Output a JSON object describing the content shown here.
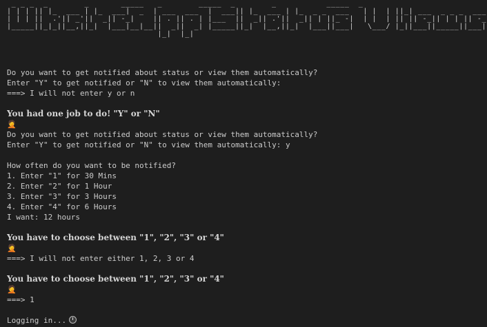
{
  "banner": {
    "ascii_art": " _ _ _  _        _       _____   _        _____  _        _           _____  _\n| | | || |_  ___ | |_  ___|  _  | ___  ___  |  ___|| |_  ___ | |_  _ _  ___   | |  | ||_| ___  _ _ _  ___  ___\n| | | ||  .'|| _'||  _|| -_|    || . || . | |___  ||  _|| .'||  _|| | ||_ -|  | |  | || || -_|| | | || -_||  _|\n|_____||_|_||__,||_|  |___|__|__||  _||  _| |_____||_|  |__,||_|  |___||___|   \\___/ |_||___||_____||___||_|\n                                 |_|  |_|"
  },
  "terminal": {
    "lines": [
      {
        "text": "Do you want to get notified about status or view them automatically?",
        "style": "normal"
      },
      {
        "text": "Enter \"Y\" to get notified or \"N\" to view them automatically:",
        "style": "normal"
      },
      {
        "text": "===> I will not enter y or n",
        "style": "normal"
      },
      {
        "text": "",
        "style": "normal"
      },
      {
        "text": "You had one job to do! \"Y\" or \"N\"",
        "style": "bold"
      },
      {
        "text": "🤦",
        "style": "emoji"
      },
      {
        "text": "Do you want to get notified about status or view them automatically?",
        "style": "normal"
      },
      {
        "text": "Enter \"Y\" to get notified or \"N\" to view them automatically: y",
        "style": "normal"
      },
      {
        "text": "",
        "style": "normal"
      },
      {
        "text": "How often do you want to be notified?",
        "style": "normal"
      },
      {
        "text": "1. Enter \"1\" for 30 Mins",
        "style": "normal"
      },
      {
        "text": "2. Enter \"2\" for 1 Hour",
        "style": "normal"
      },
      {
        "text": "3. Enter \"3\" for 3 Hours",
        "style": "normal"
      },
      {
        "text": "4. Enter \"4\" for 6 Hours",
        "style": "normal"
      },
      {
        "text": "I want: 12 hours",
        "style": "normal"
      },
      {
        "text": "",
        "style": "normal"
      },
      {
        "text": "You have to choose between \"1\", \"2\", \"3\" or \"4\"",
        "style": "bold"
      },
      {
        "text": "🤦",
        "style": "emoji"
      },
      {
        "text": "===> I will not enter either 1, 2, 3 or 4",
        "style": "normal"
      },
      {
        "text": "",
        "style": "normal"
      },
      {
        "text": "You have to choose between \"1\", \"2\", \"3\" or \"4\"",
        "style": "bold"
      },
      {
        "text": "🤦",
        "style": "emoji"
      },
      {
        "text": "===> 1",
        "style": "normal"
      },
      {
        "text": "",
        "style": "normal"
      },
      {
        "text": "Logging in...",
        "style": "normal",
        "icon": "loading-spinner-icon"
      }
    ]
  },
  "colors": {
    "background": "#1e1e1e",
    "text": "#cccccc",
    "emoji": "#f2b632"
  }
}
